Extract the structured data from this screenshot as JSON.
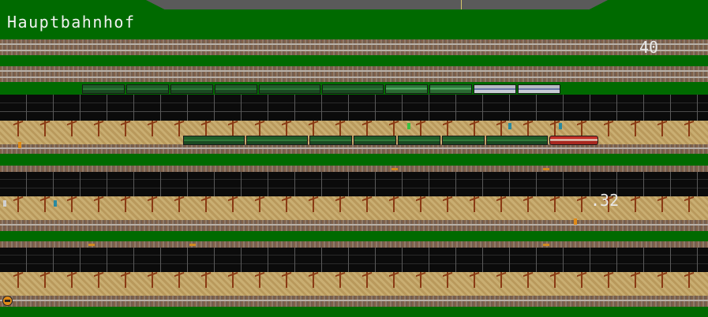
{
  "station": {
    "name": "Hauptbahnhof"
  },
  "labels": {
    "platform_top_number": "40",
    "platform_mid_number": ".32"
  },
  "colors": {
    "grass": "#006a00",
    "roof": "#0b0b0b",
    "platform": "#c2a66a",
    "pillar": "#8a3a14",
    "text": "#f2f2f2"
  },
  "icons": {
    "depot_marker": "round-sign-icon"
  }
}
